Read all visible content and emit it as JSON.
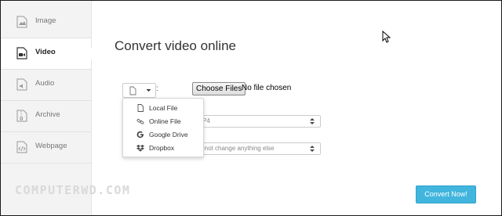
{
  "sidebar": {
    "items": [
      {
        "label": "Image",
        "icon": "image-file-icon"
      },
      {
        "label": "Video",
        "icon": "video-file-icon"
      },
      {
        "label": "Audio",
        "icon": "audio-file-icon"
      },
      {
        "label": "Archive",
        "icon": "archive-file-icon"
      },
      {
        "label": "Webpage",
        "icon": "webpage-file-icon"
      }
    ],
    "active": "Video"
  },
  "main": {
    "title": "Convert video online",
    "source_colon": ":",
    "file_button": "Choose Files",
    "file_status": "No file chosen",
    "target_format_value": "P4",
    "options_value": "o not change anything else",
    "convert_button": "Convert Now!"
  },
  "source_menu": {
    "items": [
      {
        "label": "Local File",
        "icon": "file-icon"
      },
      {
        "label": "Online File",
        "icon": "link-icon"
      },
      {
        "label": "Google Drive",
        "icon": "google-icon"
      },
      {
        "label": "Dropbox",
        "icon": "dropbox-icon"
      }
    ]
  },
  "watermark": "COMPUTERWD.COM",
  "colors": {
    "accent": "#41b5de",
    "sidebar_bg": "#f3f3f3"
  }
}
